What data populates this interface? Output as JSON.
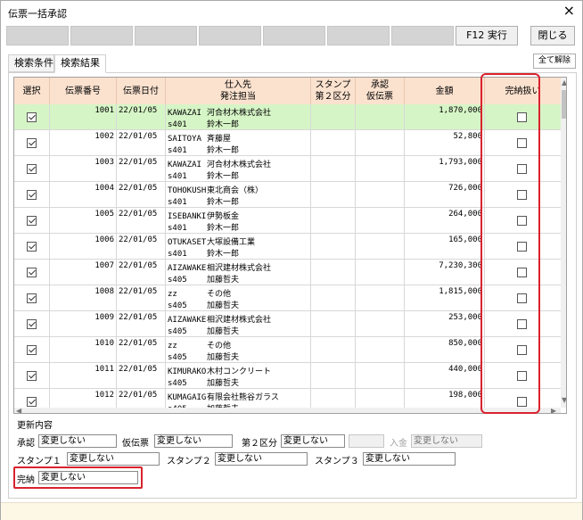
{
  "window": {
    "title": "伝票一括承認",
    "close_icon": "×"
  },
  "toolbar": {
    "f12_label": "F12 実行",
    "close_label": "閉じる"
  },
  "tabs": [
    {
      "label": "検索条件"
    },
    {
      "label": "検索結果"
    }
  ],
  "all_clear_label": "全て解除",
  "grid": {
    "headers": {
      "select": "選択",
      "slip_no": "伝票番号",
      "slip_date": "伝票日付",
      "supplier": "仕入先\n発注担当",
      "stamp": "スタンプ\n第２区分",
      "approval": "承認\n仮伝票",
      "amount": "金額",
      "completion": "完納扱い"
    },
    "rows": [
      {
        "selected": true,
        "slip_no": "1001",
        "date": "22/01/05",
        "sup_code": "KAWAZAI",
        "sup_name": "河合材木株式会社",
        "staff_code": "s401",
        "staff_name": "鈴木一郎",
        "amount": "1,870,000",
        "complete": false
      },
      {
        "selected": true,
        "slip_no": "1002",
        "date": "22/01/05",
        "sup_code": "SAITOYA",
        "sup_name": "斉藤屋",
        "staff_code": "s401",
        "staff_name": "鈴木一郎",
        "amount": "52,800",
        "complete": false
      },
      {
        "selected": true,
        "slip_no": "1003",
        "date": "22/01/05",
        "sup_code": "KAWAZAI",
        "sup_name": "河合材木株式会社",
        "staff_code": "s401",
        "staff_name": "鈴木一郎",
        "amount": "1,793,000",
        "complete": false
      },
      {
        "selected": true,
        "slip_no": "1004",
        "date": "22/01/05",
        "sup_code": "TOHOKUSH",
        "sup_name": "東北商会（株）",
        "staff_code": "s401",
        "staff_name": "鈴木一郎",
        "amount": "726,000",
        "complete": false
      },
      {
        "selected": true,
        "slip_no": "1005",
        "date": "22/01/05",
        "sup_code": "ISEBANKI",
        "sup_name": "伊勢板金",
        "staff_code": "s401",
        "staff_name": "鈴木一郎",
        "amount": "264,000",
        "complete": false
      },
      {
        "selected": true,
        "slip_no": "1006",
        "date": "22/01/05",
        "sup_code": "OTUKASET",
        "sup_name": "大塚設備工業",
        "staff_code": "s401",
        "staff_name": "鈴木一郎",
        "amount": "165,000",
        "complete": false
      },
      {
        "selected": true,
        "slip_no": "1007",
        "date": "22/01/05",
        "sup_code": "AIZAWAKE",
        "sup_name": "相沢建材株式会社",
        "staff_code": "s405",
        "staff_name": "加藤哲夫",
        "amount": "7,230,300",
        "complete": false
      },
      {
        "selected": true,
        "slip_no": "1008",
        "date": "22/01/05",
        "sup_code": "zz",
        "sup_name": "その他",
        "staff_code": "s405",
        "staff_name": "加藤哲夫",
        "amount": "1,815,000",
        "complete": false
      },
      {
        "selected": true,
        "slip_no": "1009",
        "date": "22/01/05",
        "sup_code": "AIZAWAKE",
        "sup_name": "相沢建材株式会社",
        "staff_code": "s405",
        "staff_name": "加藤哲夫",
        "amount": "253,000",
        "complete": false
      },
      {
        "selected": true,
        "slip_no": "1010",
        "date": "22/01/05",
        "sup_code": "zz",
        "sup_name": "その他",
        "staff_code": "s405",
        "staff_name": "加藤哲夫",
        "amount": "850,000",
        "complete": false
      },
      {
        "selected": true,
        "slip_no": "1011",
        "date": "22/01/05",
        "sup_code": "KIMURAKO",
        "sup_name": "木村コンクリート",
        "staff_code": "s405",
        "staff_name": "加藤哲夫",
        "amount": "440,000",
        "complete": false
      },
      {
        "selected": true,
        "slip_no": "1012",
        "date": "22/01/05",
        "sup_code": "KUMAGAIG",
        "sup_name": "有限会社熊谷ガラス",
        "staff_code": "s405",
        "staff_name": "加藤哲夫",
        "amount": "198,000",
        "complete": false
      }
    ]
  },
  "update": {
    "section_label": "更新内容",
    "approval_label": "承認",
    "approval_value": "変更しない",
    "temp_slip_label": "仮伝票",
    "temp_slip_value": "変更しない",
    "second_cat_label": "第２区分",
    "second_cat_value": "変更しない",
    "second_cat_extra_value": "",
    "deposit_label": "入金",
    "deposit_value": "変更しない",
    "stamp1_label": "スタンプ１",
    "stamp1_value": "変更しない",
    "stamp2_label": "スタンプ２",
    "stamp2_value": "変更しない",
    "stamp3_label": "スタンプ３",
    "stamp3_value": "変更しない",
    "completion_label": "完納",
    "completion_value": "変更しない"
  },
  "colors": {
    "header_bg": "#fbe2cf",
    "selected_row_bg": "#d6f5c6",
    "highlight_red": "#d9232e",
    "status_bg": "#fdf8e6"
  }
}
